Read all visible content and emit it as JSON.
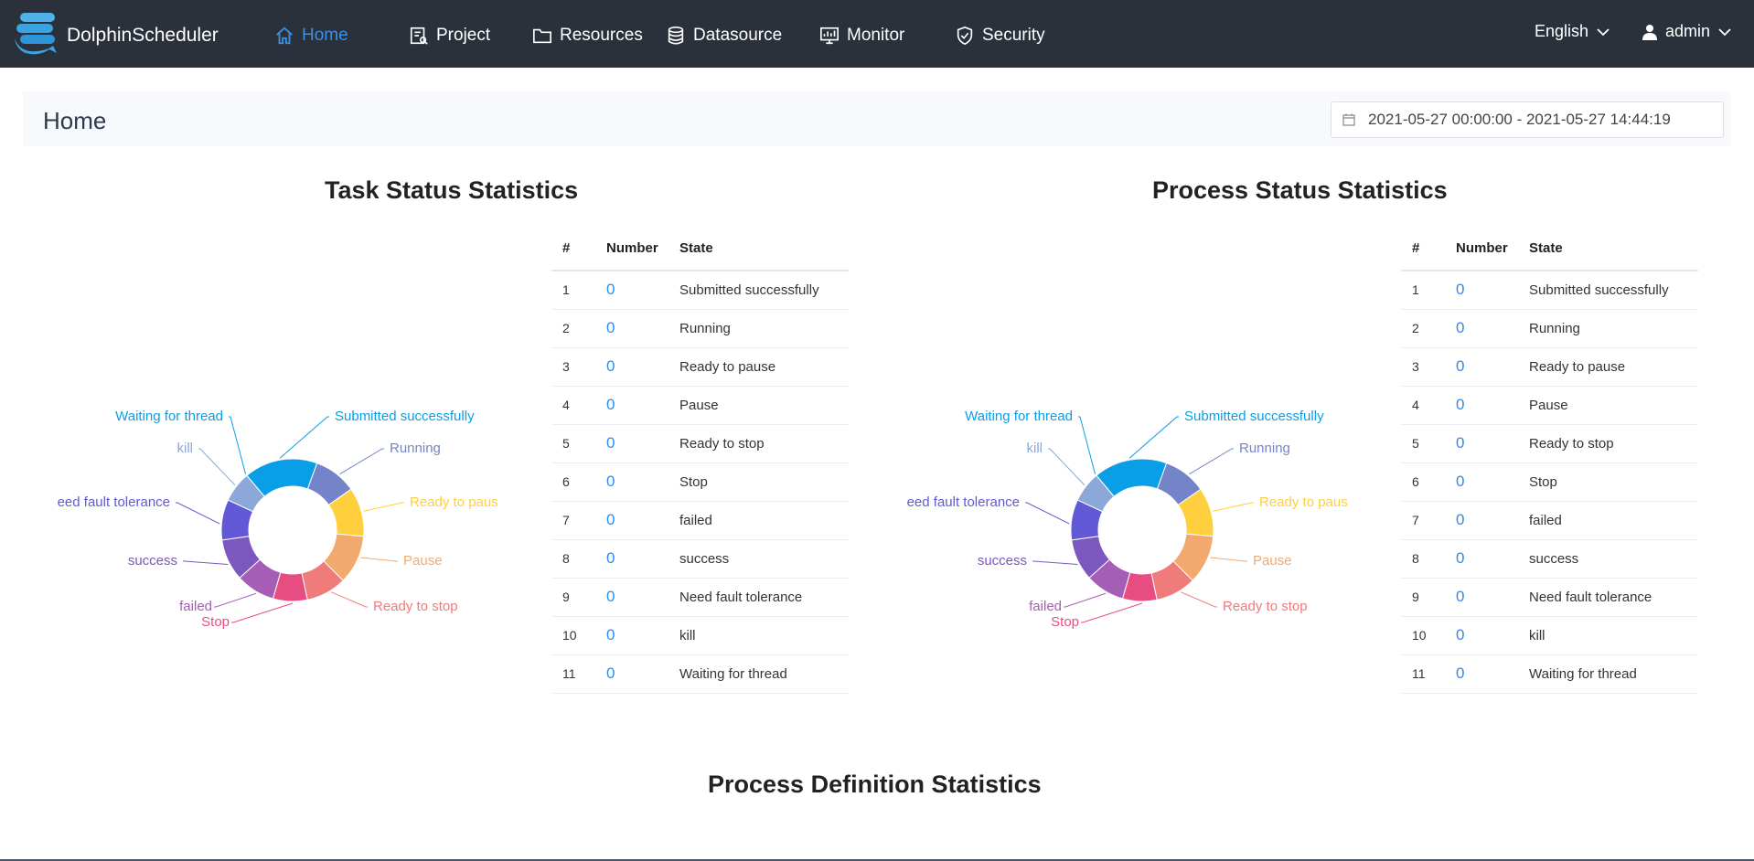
{
  "app": {
    "brand": "DolphinScheduler"
  },
  "nav": [
    {
      "label": "Home",
      "icon": "home-icon",
      "active": true
    },
    {
      "label": "Project",
      "icon": "project-icon"
    },
    {
      "label": "Resources",
      "icon": "folder-icon"
    },
    {
      "label": "Datasource",
      "icon": "database-icon"
    },
    {
      "label": "Monitor",
      "icon": "monitor-icon"
    },
    {
      "label": "Security",
      "icon": "shield-icon"
    }
  ],
  "header_right": {
    "language": "English",
    "user": "admin"
  },
  "page": {
    "title": "Home",
    "date_range": "2021-05-27 00:00:00 - 2021-05-27 14:44:19"
  },
  "task_stats": {
    "title": "Task Status Statistics",
    "columns": [
      "#",
      "Number",
      "State"
    ],
    "rows": [
      {
        "idx": "1",
        "number": "0",
        "state": "Submitted successfully"
      },
      {
        "idx": "2",
        "number": "0",
        "state": "Running"
      },
      {
        "idx": "3",
        "number": "0",
        "state": "Ready to pause"
      },
      {
        "idx": "4",
        "number": "0",
        "state": "Pause"
      },
      {
        "idx": "5",
        "number": "0",
        "state": "Ready to stop"
      },
      {
        "idx": "6",
        "number": "0",
        "state": "Stop"
      },
      {
        "idx": "7",
        "number": "0",
        "state": "failed"
      },
      {
        "idx": "8",
        "number": "0",
        "state": "success"
      },
      {
        "idx": "9",
        "number": "0",
        "state": "Need fault tolerance"
      },
      {
        "idx": "10",
        "number": "0",
        "state": "kill"
      },
      {
        "idx": "11",
        "number": "0",
        "state": "Waiting for thread"
      }
    ]
  },
  "process_stats": {
    "title": "Process Status Statistics",
    "columns": [
      "#",
      "Number",
      "State"
    ],
    "rows": [
      {
        "idx": "1",
        "number": "0",
        "state": "Submitted successfully"
      },
      {
        "idx": "2",
        "number": "0",
        "state": "Running"
      },
      {
        "idx": "3",
        "number": "0",
        "state": "Ready to pause"
      },
      {
        "idx": "4",
        "number": "0",
        "state": "Pause"
      },
      {
        "idx": "5",
        "number": "0",
        "state": "Ready to stop"
      },
      {
        "idx": "6",
        "number": "0",
        "state": "Stop"
      },
      {
        "idx": "7",
        "number": "0",
        "state": "failed"
      },
      {
        "idx": "8",
        "number": "0",
        "state": "success"
      },
      {
        "idx": "9",
        "number": "0",
        "state": "Need fault tolerance"
      },
      {
        "idx": "10",
        "number": "0",
        "state": "kill"
      },
      {
        "idx": "11",
        "number": "0",
        "state": "Waiting for thread"
      }
    ]
  },
  "definition_stats": {
    "title": "Process Definition Statistics"
  },
  "chart_data": [
    {
      "type": "pie",
      "title": "",
      "donut": true,
      "categories": [
        "Submitted successfully",
        "Running",
        "Ready to pause",
        "Pause",
        "Ready to stop",
        "Stop",
        "failed",
        "success",
        "Need fault tolerance",
        "kill",
        "Waiting for thread"
      ],
      "labels_shown": [
        "Submitted successfully",
        "Running",
        "Ready to paus",
        "Pause",
        "Ready to stop",
        "Stop",
        "failed",
        "success",
        "eed fault tolerance",
        "kill",
        "Waiting for thread"
      ],
      "values": [
        0,
        0,
        0,
        0,
        0,
        0,
        0,
        0,
        0,
        0,
        0
      ],
      "colors": [
        "#0a9ee6",
        "#7484c8",
        "#ffcf3d",
        "#f2a96e",
        "#f07b7b",
        "#e84d82",
        "#a65db5",
        "#7c57bd",
        "#6159d6",
        "#8ba8d8",
        "#0a9ee6"
      ],
      "label_colors": [
        "#0a9ee6",
        "#7484c8",
        "#ffcf3d",
        "#f2a96e",
        "#f07b7b",
        "#e84d82",
        "#a65db5",
        "#7c57bd",
        "#6159d6",
        "#8ba8d8",
        "#0a9ee6"
      ]
    },
    {
      "type": "pie",
      "title": "",
      "donut": true,
      "categories": [
        "Submitted successfully",
        "Running",
        "Ready to pause",
        "Pause",
        "Ready to stop",
        "Stop",
        "failed",
        "success",
        "Need fault tolerance",
        "kill",
        "Waiting for thread"
      ],
      "labels_shown": [
        "Submitted successfully",
        "Running",
        "Ready to paus",
        "Pause",
        "Ready to stop",
        "Stop",
        "failed",
        "success",
        "eed fault tolerance",
        "kill",
        "Waiting for thread"
      ],
      "values": [
        0,
        0,
        0,
        0,
        0,
        0,
        0,
        0,
        0,
        0,
        0
      ],
      "colors": [
        "#0a9ee6",
        "#7484c8",
        "#ffcf3d",
        "#f2a96e",
        "#f07b7b",
        "#e84d82",
        "#a65db5",
        "#7c57bd",
        "#6159d6",
        "#8ba8d8",
        "#0a9ee6"
      ],
      "label_colors": [
        "#0a9ee6",
        "#7484c8",
        "#ffcf3d",
        "#f2a96e",
        "#f07b7b",
        "#e84d82",
        "#a65db5",
        "#7c57bd",
        "#6159d6",
        "#8ba8d8",
        "#0a9ee6"
      ]
    }
  ]
}
